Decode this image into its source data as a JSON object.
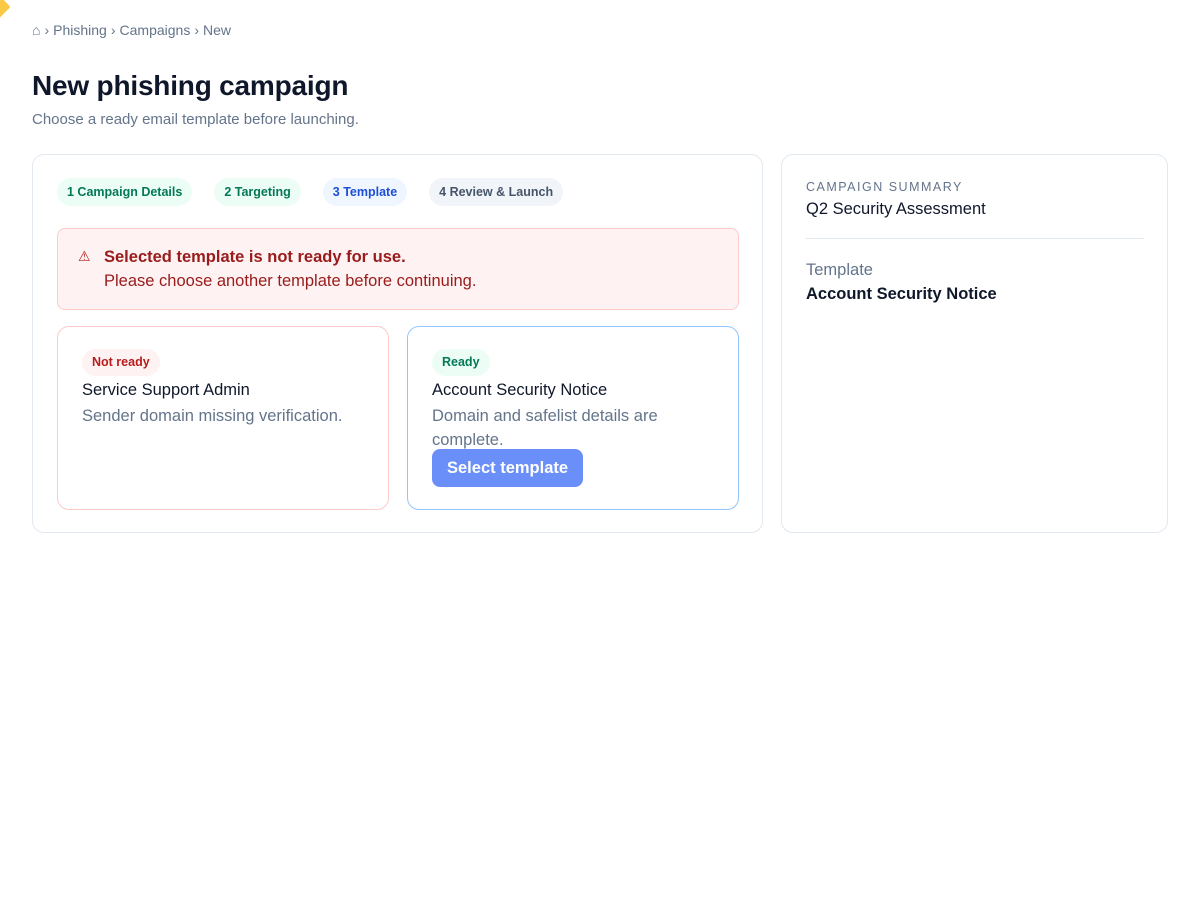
{
  "breadcrumb": {
    "home_icon": "⌂",
    "separator": "›",
    "items": [
      "Phishing",
      "Campaigns",
      "New"
    ]
  },
  "page": {
    "title": "New phishing campaign",
    "subtitle": "Choose a ready email template before launching."
  },
  "steps": [
    {
      "label": "1 Campaign Details",
      "state": "done"
    },
    {
      "label": "2 Targeting",
      "state": "done"
    },
    {
      "label": "3 Template",
      "state": "current"
    },
    {
      "label": "4 Review & Launch",
      "state": "pending"
    }
  ],
  "alert": {
    "icon": "⚠",
    "title": "Selected template is not ready for use.",
    "message": "Please choose another template before continuing."
  },
  "templates": [
    {
      "status": "Not ready",
      "name": "Service Support Admin",
      "description": "Sender domain missing verification."
    },
    {
      "status": "Ready",
      "name": "Account Security Notice",
      "description": "Domain and safelist details are complete.",
      "button_label": "Select template"
    }
  ],
  "summary": {
    "label": "CAMPAIGN SUMMARY",
    "campaign_name": "Q2 Security Assessment",
    "template_label": "Template",
    "template_value": "Account Security Notice"
  },
  "colors": {
    "accent": "#6b8ff9",
    "error": "#991b1b",
    "success": "#047857"
  }
}
